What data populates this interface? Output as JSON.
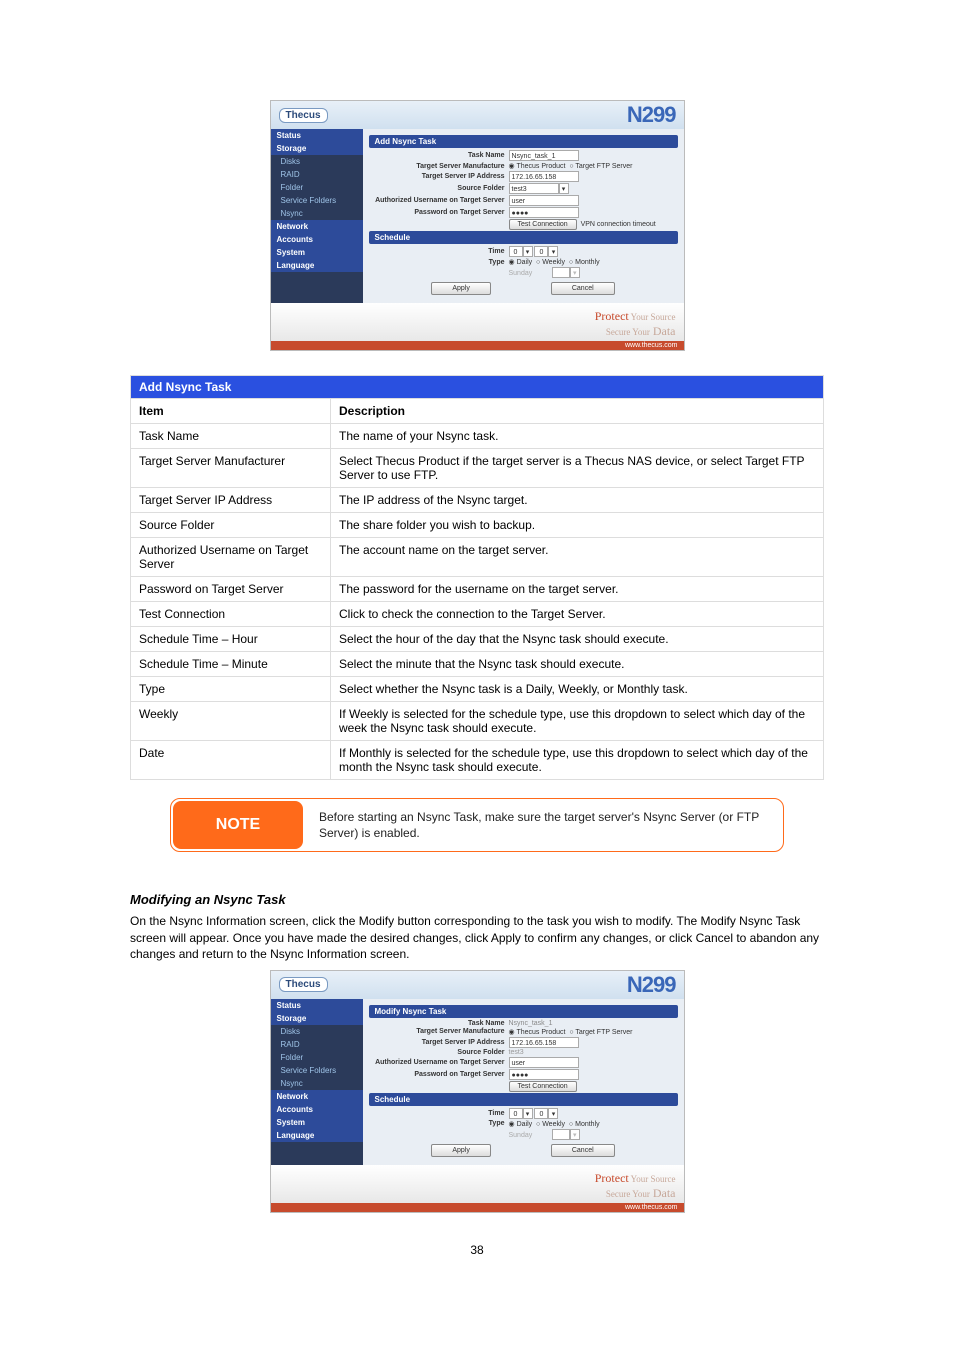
{
  "page_number": "38",
  "screenshot1": {
    "logo": "Thecus",
    "product": "N299",
    "sidebar": {
      "sections": [
        {
          "title": "Status",
          "items": []
        },
        {
          "title": "Storage",
          "items": [
            "Disks",
            "RAID",
            "Folder",
            "Service Folders",
            "Nsync"
          ]
        },
        {
          "title": "Network",
          "items": []
        },
        {
          "title": "Accounts",
          "items": []
        },
        {
          "title": "System",
          "items": []
        },
        {
          "title": "Language",
          "items": []
        }
      ]
    },
    "panel_title": "Add Nsync Task",
    "fields": {
      "task_name_label": "Task Name",
      "task_name_value": "Nsync_task_1",
      "manufacture_label": "Target Server Manufacture",
      "manufacture_opt1": "Thecus Product",
      "manufacture_opt2": "Target FTP Server",
      "ip_label": "Target Server IP Address",
      "ip_value": "172.16.65.158",
      "source_folder_label": "Source Folder",
      "source_folder_value": "test3",
      "user_label": "Authorized Username on Target Server",
      "user_value": "user",
      "pass_label": "Password on Target Server",
      "pass_value": "●●●●",
      "test_btn": "Test Connection",
      "vpn_text": "VPN connection timeout"
    },
    "schedule": {
      "title": "Schedule",
      "time_label": "Time",
      "time_h": "0",
      "time_m": "0",
      "type_label": "Type",
      "type_daily": "Daily",
      "type_weekly": "Weekly",
      "type_monthly": "Monthly",
      "week_day": "Sunday"
    },
    "apply": "Apply",
    "cancel": "Cancel",
    "footer_protect": "Protect",
    "footer_your_source": "Your Source",
    "footer_secure_your": "Secure Your",
    "footer_data": "Data",
    "footer_url": "www.thecus.com"
  },
  "table": {
    "hdr_left": "Add Nsync Task",
    "hdr_right": "",
    "col_item": "Item",
    "col_desc": "Description",
    "rows": [
      {
        "item": "Task Name",
        "desc": "The name of your Nsync task."
      },
      {
        "item": "Target Server Manufacturer",
        "desc": "Select Thecus Product if the target server is a Thecus NAS device, or select Target FTP Server to use FTP."
      },
      {
        "item": "Target Server IP Address",
        "desc": "The IP address of the Nsync target."
      },
      {
        "item": "Source Folder",
        "desc": "The share folder you wish to backup."
      },
      {
        "item": "Authorized Username on Target Server",
        "desc": "The account name on the target server."
      },
      {
        "item": "Password on Target Server",
        "desc": "The password for the username on the target server."
      },
      {
        "item": "Test Connection",
        "desc": "Click to check the connection to the Target Server."
      },
      {
        "item": "Schedule Time – Hour",
        "desc": "Select the hour of the day that the Nsync task should execute."
      },
      {
        "item": "Schedule Time – Minute",
        "desc": "Select the minute that the Nsync task should execute."
      },
      {
        "item": "Type",
        "desc": "Select whether the Nsync task is a Daily, Weekly, or Monthly task."
      },
      {
        "item": "Weekly",
        "desc": "If Weekly is selected for the schedule type, use this dropdown to select which day of the week the Nsync task should execute."
      },
      {
        "item": "Date",
        "desc": "If Monthly is selected for the schedule type, use this dropdown to select which day of the month the Nsync task should execute."
      }
    ]
  },
  "note": {
    "label": "NOTE",
    "text": "Before starting an Nsync Task, make sure the target server's Nsync Server (or FTP Server) is enabled."
  },
  "modify_section": {
    "title": "Modifying an Nsync Task",
    "para1": "On the Nsync Information screen, click the Modify button corresponding to the task you wish to modify. The Modify Nsync Task screen will appear. Once you have made the desired changes, click Apply to confirm any changes, or click Cancel to abandon any changes and return to the Nsync Information screen."
  },
  "screenshot2": {
    "panel_title": "Modify Nsync Task"
  }
}
